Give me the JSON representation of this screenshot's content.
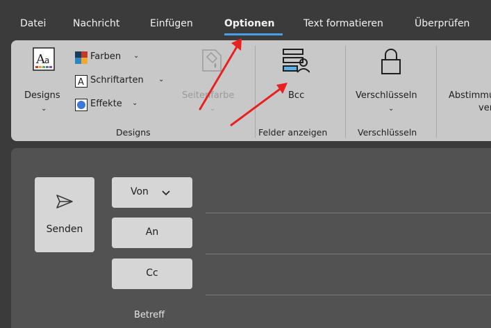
{
  "tabs": [
    {
      "label": "Datei"
    },
    {
      "label": "Nachricht"
    },
    {
      "label": "Einfügen"
    },
    {
      "label": "Optionen"
    },
    {
      "label": "Text formatieren"
    },
    {
      "label": "Überprüfen"
    }
  ],
  "active_tab": "Optionen",
  "ribbon": {
    "designs": {
      "button_label": "Designs",
      "colors_label": "Farben",
      "fonts_label": "Schriftarten",
      "effects_label": "Effekte",
      "page_color_label": "Seitenfarbe",
      "group_label": "Designs"
    },
    "show_fields": {
      "bcc_label": "Bcc",
      "group_label": "Felder anzeigen"
    },
    "encrypt": {
      "button_label": "Verschlüsseln",
      "group_label": "Verschlüsseln"
    },
    "voting": {
      "label_line1": "Abstimmungsschaltflächen",
      "label_line2": "verwenden"
    }
  },
  "compose": {
    "send_label": "Senden",
    "from_label": "Von",
    "to_label": "An",
    "cc_label": "Cc",
    "subject_label": "Betreff"
  },
  "colors": {
    "accent": "#4aa0e6",
    "annotation_arrow": "#e8211f"
  }
}
